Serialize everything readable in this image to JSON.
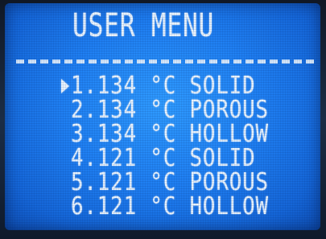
{
  "menu": {
    "title": "USER MENU",
    "selected_index": 0,
    "items": [
      {
        "label": "1.134 °C SOLID"
      },
      {
        "label": "2.134 °C POROUS"
      },
      {
        "label": "3.134 °C HOLLOW"
      },
      {
        "label": "4.121 °C SOLID"
      },
      {
        "label": "5.121 °C POROUS"
      },
      {
        "label": "6.121 °C HOLLOW"
      }
    ]
  },
  "colors": {
    "screen_background": "#1f7ff2",
    "text": "#e9f4ff"
  },
  "icons": {
    "cursor": "triangle-right-icon"
  }
}
